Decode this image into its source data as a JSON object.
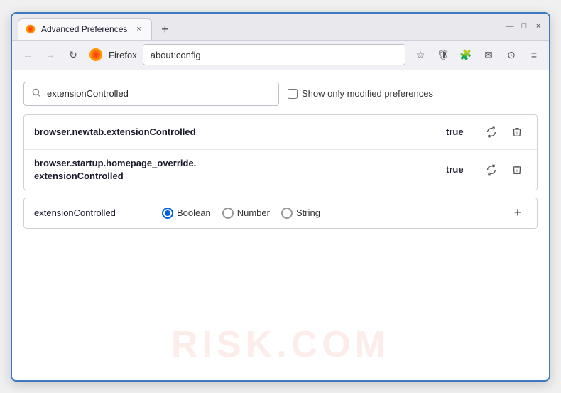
{
  "window": {
    "title": "Advanced Preferences",
    "tab_close": "×",
    "new_tab": "+",
    "minimize": "—",
    "maximize": "□",
    "close": "×"
  },
  "navbar": {
    "back": "←",
    "forward": "→",
    "refresh": "↻",
    "firefox_label": "Firefox",
    "url": "about:config",
    "bookmark_icon": "☆",
    "shield_icon": "🛡",
    "extension_icon": "🧩",
    "mail_icon": "✉",
    "account_icon": "⊙",
    "menu_icon": "≡"
  },
  "search": {
    "placeholder": "extensionControlled",
    "value": "extensionControlled",
    "show_modified_label": "Show only modified preferences"
  },
  "preferences": {
    "rows": [
      {
        "name": "browser.newtab.extensionControlled",
        "value": "true",
        "two_line": false
      },
      {
        "name": "browser.startup.homepage_override.extensionControlled",
        "value": "true",
        "two_line": true
      }
    ],
    "reset_icon": "⇌",
    "delete_icon": "🗑"
  },
  "new_pref": {
    "name": "extensionControlled",
    "types": [
      {
        "label": "Boolean",
        "selected": true
      },
      {
        "label": "Number",
        "selected": false
      },
      {
        "label": "String",
        "selected": false
      }
    ],
    "add_icon": "+"
  },
  "watermark": {
    "text": "RISK.COM"
  }
}
